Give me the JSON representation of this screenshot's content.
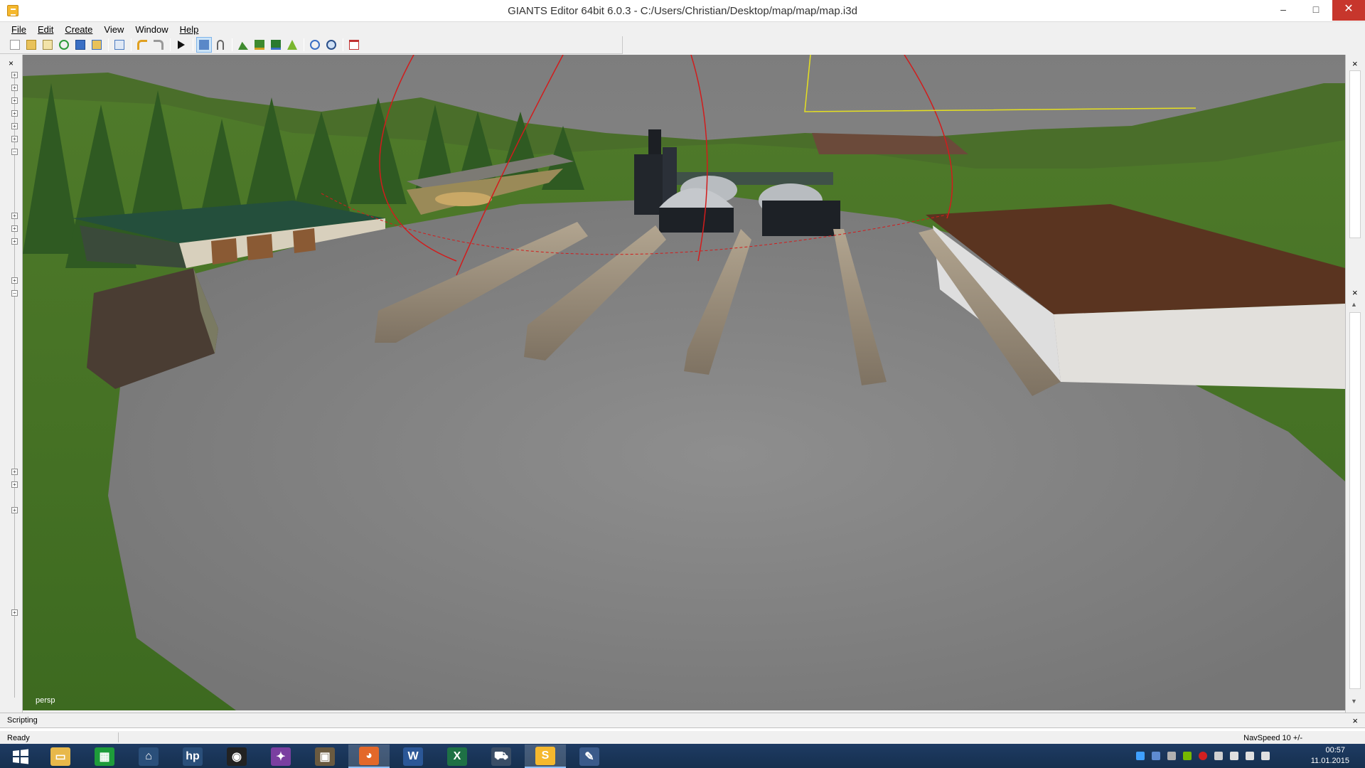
{
  "window": {
    "title": "GIANTS Editor 64bit 6.0.3 - C:/Users/Christian/Desktop/map/map/map.i3d",
    "min_glyph": "–",
    "max_glyph": "□",
    "close_glyph": "✕"
  },
  "menu": {
    "items": [
      {
        "label": "File"
      },
      {
        "label": "Edit"
      },
      {
        "label": "Create"
      },
      {
        "label": "View"
      },
      {
        "label": "Window"
      },
      {
        "label": "Help"
      }
    ]
  },
  "toolbar": {
    "buttons": [
      "new-file-icon",
      "open-file-icon",
      "edit-file-icon",
      "refresh-icon",
      "save-icon",
      "export-icon",
      "reload-icon",
      "undo-icon",
      "redo-icon",
      "play-icon",
      "select-tool-icon",
      "move-tool-icon",
      "terrain-sculpt-icon",
      "terrain-paint-icon",
      "foliage-paint-icon",
      "decal-paint-icon",
      "rotate-icon",
      "scale-icon",
      "delete-icon"
    ]
  },
  "left_panel": {
    "close_glyph": "×",
    "node_glyphs": [
      "+",
      "+",
      "+",
      "+",
      "+",
      "+",
      "–",
      "+",
      "+",
      "+",
      "+",
      "–",
      "+",
      "+",
      "+",
      "+"
    ]
  },
  "viewport": {
    "camera_label": "persp"
  },
  "right_panel": {
    "close_glyph": "×",
    "close_glyph_2": "×",
    "up_arrow": "▲",
    "down_arrow": "▼"
  },
  "scripting": {
    "label": "Scripting",
    "close_glyph": "×"
  },
  "status": {
    "text": "Ready",
    "nav_speed": "NavSpeed 10 +/-"
  },
  "taskbar": {
    "start_icon": "windows-start-icon",
    "apps": [
      {
        "name": "file-explorer-icon",
        "color": "#e8b84a",
        "glyph": "▭"
      },
      {
        "name": "store-icon",
        "color": "#1e9c3a",
        "glyph": "▦"
      },
      {
        "name": "home-icon",
        "color": "#2a4f7a",
        "glyph": "⌂"
      },
      {
        "name": "hp-icon",
        "color": "#2a4f7a",
        "glyph": "hp"
      },
      {
        "name": "camera-icon",
        "color": "#222222",
        "glyph": "◉"
      },
      {
        "name": "color-app-icon",
        "color": "#7a3fa0",
        "glyph": "✦"
      },
      {
        "name": "game-icon",
        "color": "#6a5a40",
        "glyph": "▣"
      },
      {
        "name": "firefox-icon",
        "color": "#e3682a",
        "glyph": "◕"
      },
      {
        "name": "word-icon",
        "color": "#2b5797",
        "glyph": "W"
      },
      {
        "name": "excel-icon",
        "color": "#1e7145",
        "glyph": "X"
      },
      {
        "name": "tractor-icon",
        "color": "#3a4d66",
        "glyph": "⛟"
      },
      {
        "name": "giants-editor-icon",
        "color": "#f5b82e",
        "glyph": "S"
      },
      {
        "name": "paint-icon",
        "color": "#3a5a8a",
        "glyph": "✎"
      }
    ],
    "time": "00:57",
    "date": "11.01.2015"
  }
}
